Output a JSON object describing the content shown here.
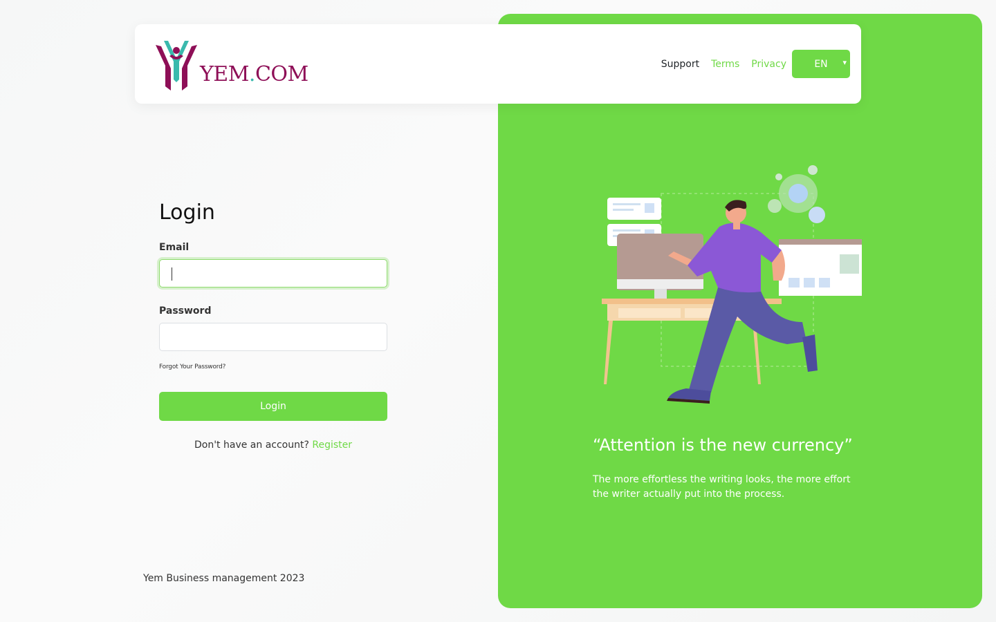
{
  "brand": {
    "logo_text": "YEM",
    "logo_dot": ".",
    "logo_suffix": "COM"
  },
  "nav": {
    "support": "Support",
    "terms": "Terms",
    "privacy": "Privacy",
    "language": "EN"
  },
  "form": {
    "title": "Login",
    "email_label": "Email",
    "email_value": "",
    "password_label": "Password",
    "password_value": "",
    "forgot": "Forgot Your Password?",
    "submit": "Login",
    "no_account": "Don't have an account?",
    "register": "Register"
  },
  "footer": {
    "text": "Yem Business management 2023"
  },
  "promo": {
    "quote": "“Attention is the new currency”",
    "subtext": "The more effortless the writing looks, the more effort the writer actually put into the process."
  },
  "colors": {
    "accent": "#6fd946",
    "brand": "#8e0f57",
    "brand_secondary": "#3ab9ad"
  }
}
